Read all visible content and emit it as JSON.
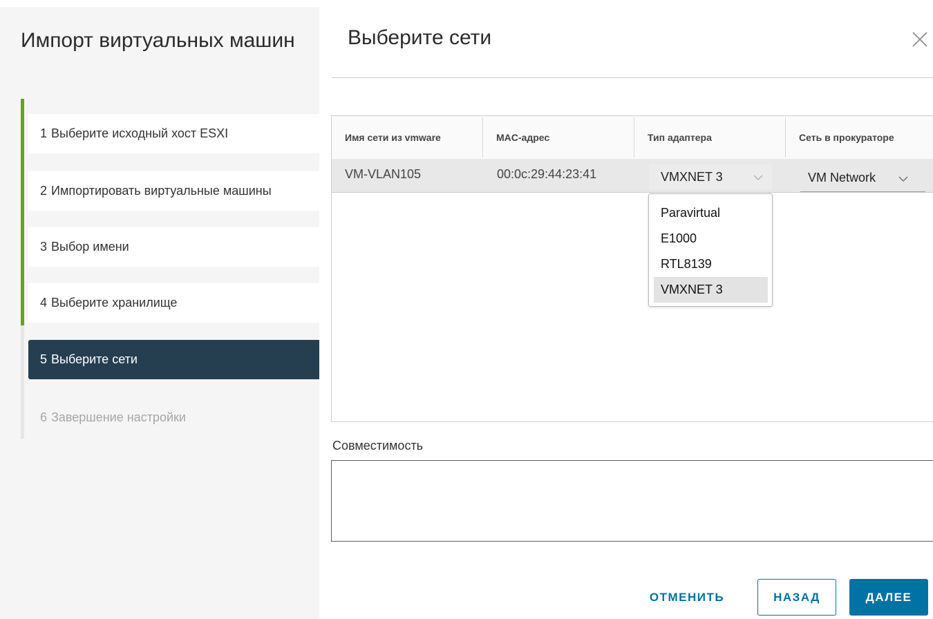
{
  "wizard": {
    "title": "Импорт виртуальных машин",
    "steps": [
      {
        "number": "1",
        "label": "Выберите исходный хост ESXI",
        "state": "done"
      },
      {
        "number": "2",
        "label": "Импортировать виртуальные машины",
        "state": "done"
      },
      {
        "number": "3",
        "label": "Выбор имени",
        "state": "done"
      },
      {
        "number": "4",
        "label": "Выберите хранилище",
        "state": "done"
      },
      {
        "number": "5",
        "label": "Выберите сети",
        "state": "active"
      },
      {
        "number": "6",
        "label": "Завершение настройки",
        "state": "pending"
      }
    ]
  },
  "page": {
    "title": "Выберите сети",
    "close_icon": "close-icon"
  },
  "grid": {
    "columns": [
      "Имя сети из vmware",
      "MAC-адрес",
      "Тип адаптера",
      "Сеть в прокураторе"
    ],
    "rows": [
      {
        "network_name": "VM-VLAN105",
        "mac": "00:0c:29:44:23:41",
        "adapter_type": "VMXNET 3",
        "target_network": "VM Network"
      }
    ]
  },
  "adapter_dropdown": {
    "options": [
      "Paravirtual",
      "E1000",
      "RTL8139",
      "VMXNET 3"
    ],
    "selected": "VMXNET 3"
  },
  "compatibility": {
    "label": "Совместимость",
    "value": ""
  },
  "footer": {
    "cancel_label": "ОТМЕНИТЬ",
    "back_label": "НАЗАД",
    "next_label": "ДАЛЕЕ"
  },
  "colors": {
    "progress_done": "#62a420",
    "active_step": "#253f51",
    "primary": "#0072a3"
  }
}
